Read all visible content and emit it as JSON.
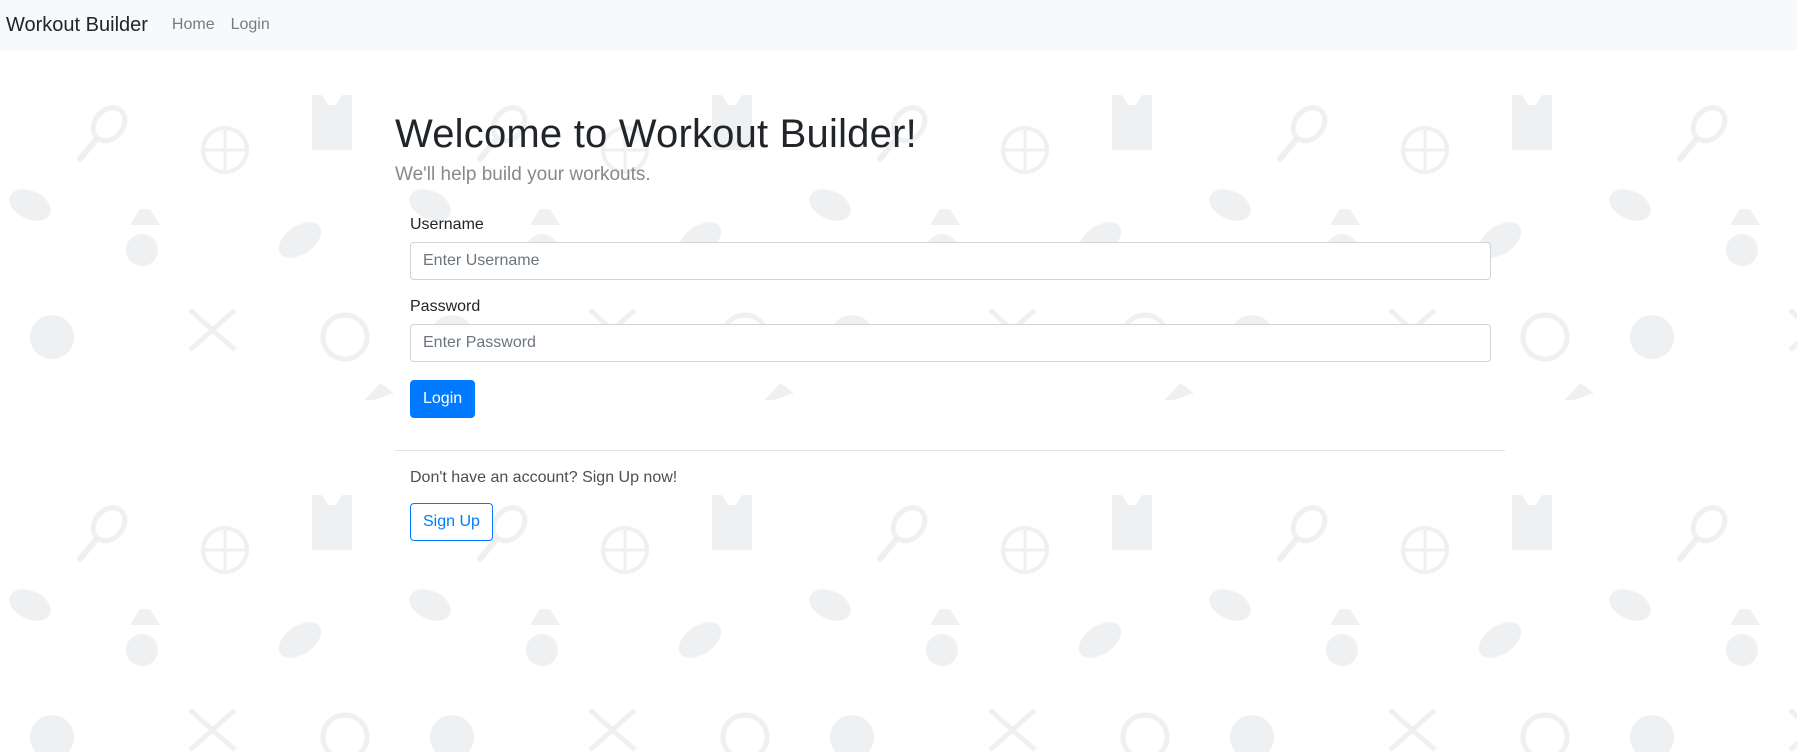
{
  "navbar": {
    "brand": "Workout Builder",
    "links": [
      "Home",
      "Login"
    ]
  },
  "main": {
    "title": "Welcome to Workout Builder!",
    "subtitle": "We'll help build your workouts.",
    "username": {
      "label": "Username",
      "placeholder": "Enter Username",
      "value": ""
    },
    "password": {
      "label": "Password",
      "placeholder": "Enter Password",
      "value": ""
    },
    "login_button": "Login",
    "signup_prompt": "Don't have an account? Sign Up now!",
    "signup_button": "Sign Up"
  },
  "background": {
    "pattern": "sports-icons",
    "icons": [
      "tennis-racket-icon",
      "basketball-icon",
      "jersey-icon",
      "football-icon",
      "medal-icon",
      "hockey-puck-icon",
      "hockey-sticks-icon",
      "soccer-ball-icon",
      "volleyball-icon",
      "shuttlecock-icon",
      "sneaker-icon",
      "tennis-ball-icon"
    ]
  },
  "colors": {
    "primary": "#007bff",
    "navbar_bg": "#f8f9fa",
    "pattern_icon": "#eef0f2"
  }
}
